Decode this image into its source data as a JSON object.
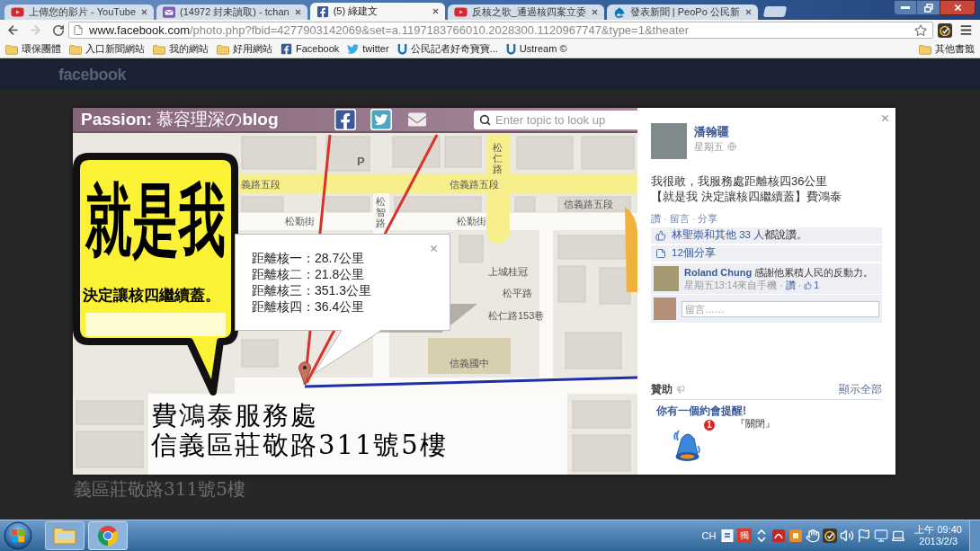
{
  "browser": {
    "tabs": [
      {
        "kind": "youtube",
        "title": "上傳您的影片 - YouTube",
        "selected": false
      },
      {
        "kind": "mail",
        "title": "(14972 封未讀取) - tchan",
        "selected": false
      },
      {
        "kind": "facebook",
        "title": "(5) 綠建文",
        "selected": true
      },
      {
        "kind": "youtube",
        "title": "反核之歌_通過核四案立委",
        "selected": false
      },
      {
        "kind": "drupal",
        "title": "發表新聞 | PeoPo 公民新",
        "selected": false
      }
    ],
    "forward_disabled": true,
    "address": {
      "host": "www.facebook.com",
      "path": "/photo.php?fbid=4277903142069&set=a.1197183766010.2028300.1120967747&type=1&theater"
    },
    "bookmarks": [
      {
        "kind": "folder",
        "label": "環保團體"
      },
      {
        "kind": "folder",
        "label": "入口新聞網站"
      },
      {
        "kind": "folder",
        "label": "我的網站"
      },
      {
        "kind": "folder",
        "label": "好用網站"
      },
      {
        "kind": "facebook",
        "label": "Facebook"
      },
      {
        "kind": "twitter",
        "label": "twitter"
      },
      {
        "kind": "ustream",
        "label": "公民記者好奇寶寶..."
      },
      {
        "kind": "ustream",
        "label": "Ustream ©"
      }
    ],
    "other_bookmarks": "其他書籤"
  },
  "page": {
    "logo": "facebook",
    "background_caption": "義區莊敬路311號5樓"
  },
  "photo": {
    "blog_title": "**Passion:** 慕容理深の**blog**",
    "search_placeholder": "Enter topic to look up",
    "map_labels": [
      {
        "kind": "horizontal",
        "text": "義路五段"
      },
      {
        "kind": "horizontal",
        "text": "信義路五段"
      },
      {
        "kind": "horizontal",
        "text": "信義路五段"
      },
      {
        "kind": "horizontal",
        "text": "松勤街"
      },
      {
        "kind": "horizontal",
        "text": "松勤街"
      },
      {
        "kind": "vertical",
        "text": "松仁路"
      },
      {
        "kind": "vertical",
        "text": "松智路"
      },
      {
        "kind": "horizontal",
        "text": "上城桂冠"
      },
      {
        "kind": "horizontal",
        "text": "松平路"
      },
      {
        "kind": "horizontal",
        "text": "松仁路153巷"
      },
      {
        "kind": "horizontal",
        "text": "信義國中"
      },
      {
        "kind": "symbol",
        "text": "P"
      }
    ],
    "bubble": {
      "headline": "就是我",
      "subline": "決定讓核四繼續蓋。"
    },
    "info_window": [
      "距離核一：28.7公里",
      "距離核二：21.8公里",
      "距離核三：351.3公里",
      "距離核四：36.4公里"
    ],
    "caption": [
      "費鴻泰服務處",
      "信義區莊敬路311號5樓"
    ]
  },
  "post": {
    "author": "潘翰疆",
    "time": "星期五",
    "text": [
      "我很敢，我服務處距離核四36公里",
      "【就是我 決定讓核四繼續蓋】費鴻泰"
    ],
    "actions": [
      {
        "kind": "link",
        "text": "讚"
      },
      {
        "kind": "separator",
        "text": "·"
      },
      {
        "kind": "link",
        "text": "留言"
      },
      {
        "kind": "separator",
        "text": "·"
      },
      {
        "kind": "link",
        "text": "分享"
      }
    ],
    "likes": {
      "names": "林聖崇和其他 33 人",
      "suffix": "都說讚。"
    },
    "shares": "12個分享",
    "comments": [
      {
        "author": "Roland Chung",
        "text": "感謝他累積人民的反動力。",
        "meta": [
          {
            "kind": "text",
            "text": "星期五13:14來自手機"
          },
          {
            "kind": "separator",
            "text": "·"
          },
          {
            "kind": "link",
            "text": "讚"
          },
          {
            "kind": "separator",
            "text": "·"
          },
          {
            "kind": "likes",
            "text": "1"
          }
        ]
      }
    ],
    "comment_placeholder": "留言……"
  },
  "sponsored": {
    "title": "贊助",
    "show_all": "顯示全部",
    "ad": {
      "headline": "你有一個約會提醒!",
      "dismiss": "『關閉』",
      "badge": "1"
    }
  },
  "taskbar": {
    "language": "CH",
    "ime": "獨",
    "time": "上午 09:40",
    "date": "2013/2/3"
  }
}
